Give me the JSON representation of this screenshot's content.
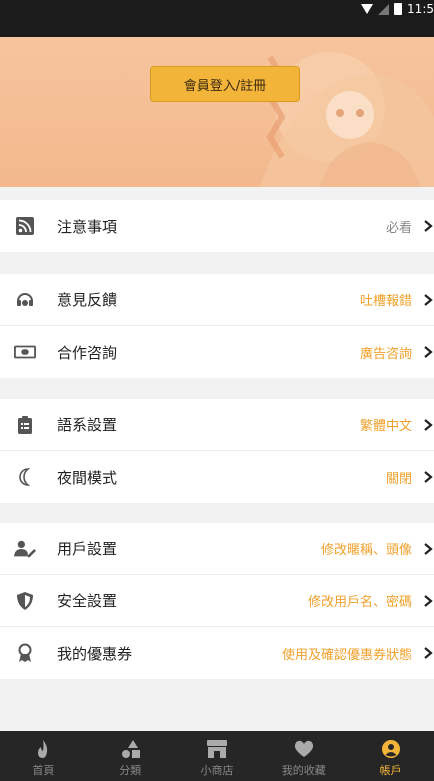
{
  "status_bar": {
    "time": "11:5"
  },
  "banner": {
    "login_label": "會員登入/註冊"
  },
  "groups": [
    {
      "rows": [
        {
          "label": "注意事項",
          "value": "必看",
          "icon": "rss-icon"
        }
      ]
    },
    {
      "rows": [
        {
          "label": "意見反饋",
          "value": "吐槽報錯",
          "icon": "headset-icon"
        },
        {
          "label": "合作咨詢",
          "value": "廣告咨詢",
          "icon": "money-icon"
        }
      ]
    },
    {
      "rows": [
        {
          "label": "語系設置",
          "value": "繁體中文",
          "icon": "clipboard-icon"
        },
        {
          "label": "夜間模式",
          "value": "關閉",
          "icon": "moon-icon"
        }
      ]
    },
    {
      "rows": [
        {
          "label": "用戶設置",
          "value": "修改暱稱、頭像",
          "icon": "user-edit-icon"
        },
        {
          "label": "安全設置",
          "value": "修改用戶名、密碼",
          "icon": "shield-icon"
        },
        {
          "label": "我的優惠券",
          "value": "使用及確認優惠券狀態",
          "icon": "award-icon"
        }
      ]
    }
  ],
  "bottom_nav": [
    {
      "label": "首頁",
      "icon": "fire-icon"
    },
    {
      "label": "分類",
      "icon": "shapes-icon"
    },
    {
      "label": "小商店",
      "icon": "store-icon"
    },
    {
      "label": "我的收藏",
      "icon": "heart-icon"
    },
    {
      "label": "帳戶",
      "icon": "user-circle-icon",
      "active": true
    }
  ],
  "colors": {
    "accent": "#f3b43a",
    "value_text": "#f0a02a",
    "nav_bg": "#262626"
  }
}
